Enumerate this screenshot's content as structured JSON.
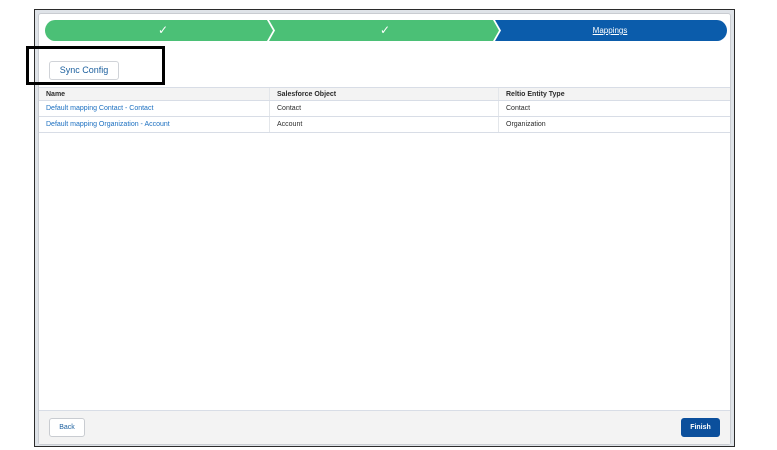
{
  "colors": {
    "completed_stage": "#4bc076",
    "current_stage": "#0b5cab",
    "link": "#1b6fc0",
    "finish_button": "#0b4f9c"
  },
  "path": {
    "stages": [
      {
        "status": "complete",
        "icon": "check-icon",
        "glyph": "✓"
      },
      {
        "status": "complete",
        "icon": "check-icon",
        "glyph": "✓"
      },
      {
        "status": "current",
        "label": "Mappings"
      }
    ]
  },
  "toolbar": {
    "sync_label": "Sync Config"
  },
  "table": {
    "headers": [
      "Name",
      "Salesforce Object",
      "Reltio Entity Type"
    ],
    "rows": [
      [
        "Default mapping Contact - Contact",
        "Contact",
        "Contact"
      ],
      [
        "Default mapping Organization - Account",
        "Account",
        "Organization"
      ]
    ]
  },
  "footer": {
    "back_label": "Back",
    "finish_label": "Finish"
  }
}
